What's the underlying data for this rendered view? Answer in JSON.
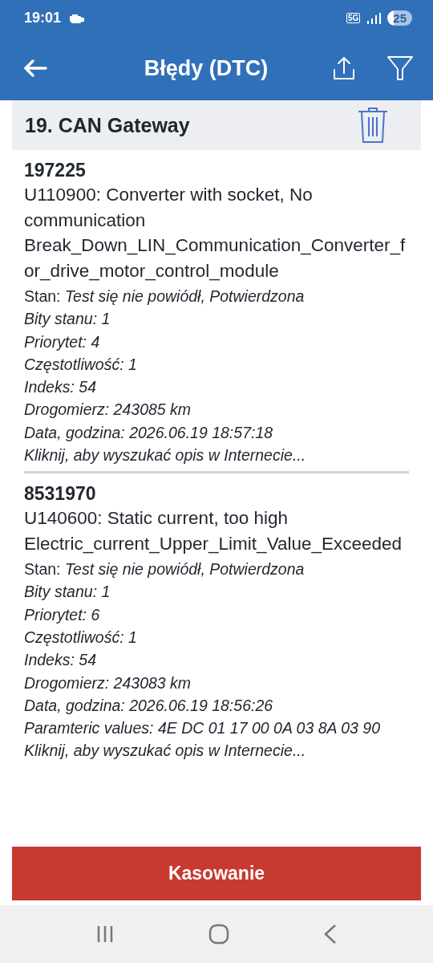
{
  "status_bar": {
    "time": "19:01",
    "network": "5G",
    "battery": "25"
  },
  "app_bar": {
    "title": "Błędy (DTC)"
  },
  "module": {
    "title": "19. CAN Gateway"
  },
  "errors": [
    {
      "code": "197225",
      "description": "U110900: Converter with socket, No communication Break_Down_LIN_Communication_Converter_for_drive_motor_control_module",
      "details": [
        {
          "kind": "mixed",
          "text": "Stan: *Test się nie powiódł, Potwierdzona*"
        },
        {
          "kind": "italic",
          "text": "Bity stanu: 1"
        },
        {
          "kind": "italic",
          "text": "Priorytet: 4"
        },
        {
          "kind": "italic",
          "text": "Częstotliwość: 1"
        },
        {
          "kind": "italic",
          "text": "Indeks: 54"
        },
        {
          "kind": "italic",
          "text": "Drogomierz: 243085 km"
        },
        {
          "kind": "italic",
          "text": "Data, godzina: 2026.06.19 18:57:18"
        }
      ],
      "link": "Kliknij, aby wyszukać opis w Internecie..."
    },
    {
      "code": "8531970",
      "description": "U140600: Static current, too high Electric_current_Upper_Limit_Value_Exceeded",
      "details": [
        {
          "kind": "mixed",
          "text": "Stan: *Test się nie powiódł, Potwierdzona*"
        },
        {
          "kind": "italic",
          "text": "Bity stanu: 1"
        },
        {
          "kind": "italic",
          "text": "Priorytet: 6"
        },
        {
          "kind": "italic",
          "text": "Częstotliwość: 1"
        },
        {
          "kind": "italic",
          "text": "Indeks: 54"
        },
        {
          "kind": "italic",
          "text": "Drogomierz: 243083 km"
        },
        {
          "kind": "italic",
          "text": "Data, godzina: 2026.06.19 18:56:26"
        },
        {
          "kind": "italic",
          "text": "Paramteric values:  4E DC 01 17 00 0A 03 8A 03 90"
        }
      ],
      "link": "Kliknij, aby wyszukać opis w Internecie..."
    }
  ],
  "button": "Kasowanie"
}
